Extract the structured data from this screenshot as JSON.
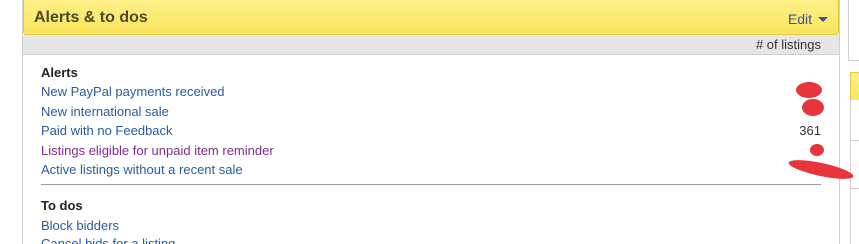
{
  "panel": {
    "title": "Alerts & to dos",
    "edit_label": "Edit",
    "column_header": "# of listings"
  },
  "alerts": {
    "heading": "Alerts",
    "items": [
      {
        "label": "New PayPal payments received",
        "count": ""
      },
      {
        "label": "New international sale",
        "count": ""
      },
      {
        "label": "Paid with no Feedback",
        "count": "361"
      },
      {
        "label": "Listings eligible for unpaid item reminder",
        "count": ""
      },
      {
        "label": "Active listings without a recent sale",
        "count": ""
      }
    ]
  },
  "todos": {
    "heading": "To dos",
    "items": [
      {
        "label": "Block bidders"
      },
      {
        "label": "Cancel bids for a listing"
      }
    ]
  },
  "colors": {
    "header_yellow": "#fae55b",
    "link_blue": "#2b5aa1",
    "visited_purple": "#7b2c8e",
    "redaction_red": "#e8343c"
  }
}
